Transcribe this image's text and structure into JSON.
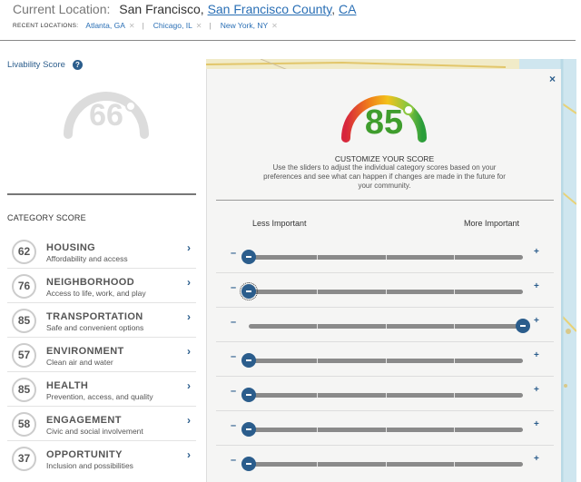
{
  "header": {
    "current_label": "Current Location:",
    "city": "San Francisco,",
    "county": "San Francisco County",
    "state": "CA",
    "recent_label": "RECENT LOCATIONS:",
    "recent": [
      {
        "name": "Atlanta, GA"
      },
      {
        "name": "Chicago, IL"
      },
      {
        "name": "New York, NY"
      }
    ],
    "remove_glyph": "✕",
    "separator": "|"
  },
  "livability": {
    "title": "Livability Score",
    "help_glyph": "?",
    "score": "66",
    "gauge_color": "#dcdcdc"
  },
  "categories": {
    "title": "CATEGORY SCORE",
    "items": [
      {
        "score": "62",
        "name": "HOUSING",
        "desc": "Affordability and access"
      },
      {
        "score": "76",
        "name": "NEIGHBORHOOD",
        "desc": "Access to life, work, and play"
      },
      {
        "score": "85",
        "name": "TRANSPORTATION",
        "desc": "Safe and convenient options"
      },
      {
        "score": "57",
        "name": "ENVIRONMENT",
        "desc": "Clean air and water"
      },
      {
        "score": "85",
        "name": "HEALTH",
        "desc": "Prevention, access, and quality"
      },
      {
        "score": "58",
        "name": "ENGAGEMENT",
        "desc": "Civic and social involvement"
      },
      {
        "score": "37",
        "name": "OPPORTUNITY",
        "desc": "Inclusion and possibilities"
      }
    ],
    "arrow_glyph": "›"
  },
  "modal": {
    "close_glyph": "×",
    "score": "85",
    "score_color": "#3f9d2d",
    "title": "CUSTOMIZE YOUR SCORE",
    "description": "Use the sliders to adjust the individual category scores based on your preferences and see what can happen if changes are made in the future for your community.",
    "less_label": "Less Important",
    "more_label": "More Important",
    "minus_glyph": "–",
    "plus_glyph": "+",
    "sliders": [
      {
        "category": "HOUSING",
        "value": 0
      },
      {
        "category": "NEIGHBORHOOD",
        "value": 0
      },
      {
        "category": "TRANSPORTATION",
        "value": 1
      },
      {
        "category": "ENVIRONMENT",
        "value": 0
      },
      {
        "category": "HEALTH",
        "value": 0
      },
      {
        "category": "ENGAGEMENT",
        "value": 0
      },
      {
        "category": "OPPORTUNITY",
        "value": 0
      }
    ]
  },
  "colors": {
    "accent": "#2b5d8c",
    "link": "#2a6fb5",
    "map": "#f1ebc8"
  }
}
